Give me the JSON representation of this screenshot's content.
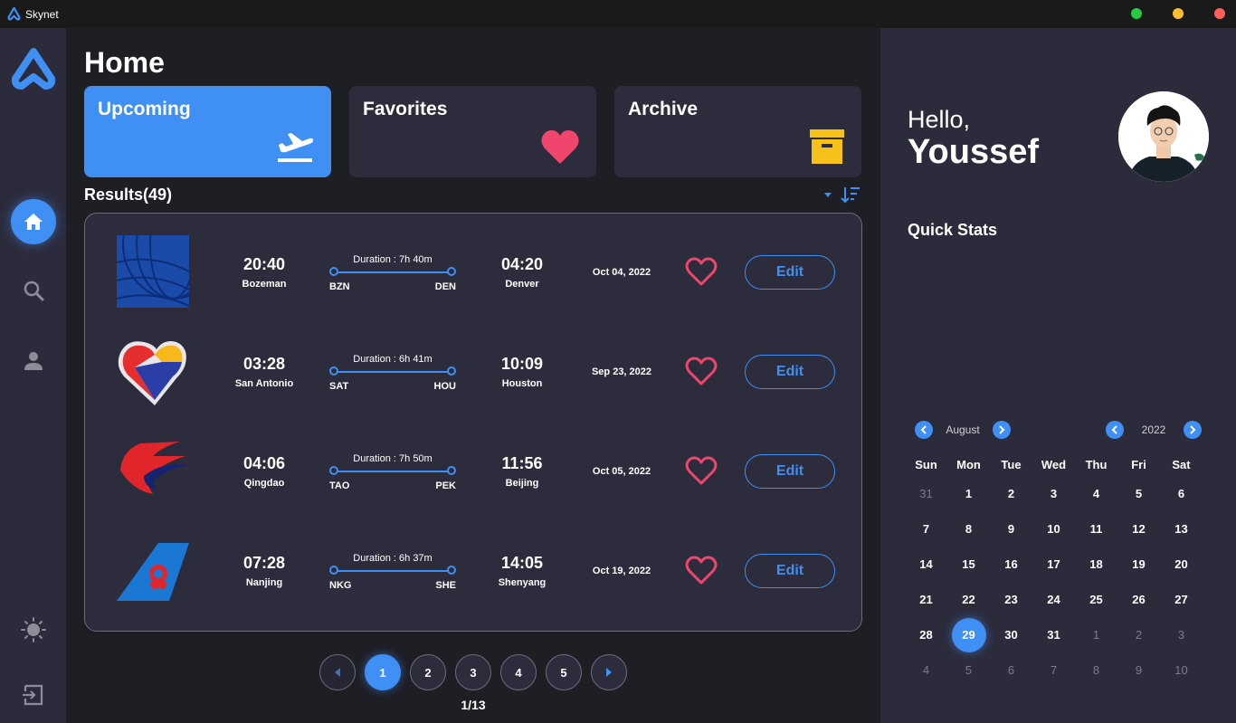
{
  "window": {
    "title": "Skynet",
    "controls": [
      {
        "name": "maximize",
        "color": "#27c93f"
      },
      {
        "name": "minimize",
        "color": "#ffbd2e"
      },
      {
        "name": "close",
        "color": "#ff5f56"
      }
    ]
  },
  "theme": {
    "accent": "#3f8ff5",
    "heart": "#f0466e",
    "archive": "#f6c21a"
  },
  "sidebar": {
    "logo": "skynet-logo-icon",
    "items": [
      {
        "name": "home",
        "icon": "home-icon",
        "active": true
      },
      {
        "name": "search",
        "icon": "search-icon",
        "active": false
      },
      {
        "name": "profile",
        "icon": "user-icon",
        "active": false
      }
    ],
    "bottom": [
      {
        "name": "theme-toggle",
        "icon": "sun-icon"
      },
      {
        "name": "logout",
        "icon": "logout-icon"
      }
    ]
  },
  "main": {
    "title": "Home",
    "categories": [
      {
        "label": "Upcoming",
        "icon": "airplane-departure-icon",
        "active": true
      },
      {
        "label": "Favorites",
        "icon": "heart-icon",
        "active": false
      },
      {
        "label": "Archive",
        "icon": "archive-box-icon",
        "active": false
      }
    ],
    "results_label": "Results(49)",
    "flights": [
      {
        "airline_icon": "united-globe-icon",
        "dep_time": "20:40",
        "dep_city": "Bozeman",
        "duration": "Duration : 7h 40m",
        "from": "BZN",
        "to": "DEN",
        "arr_time": "04:20",
        "arr_city": "Denver",
        "date": "Oct 04, 2022",
        "edit": "Edit"
      },
      {
        "airline_icon": "southwest-heart-icon",
        "dep_time": "03:28",
        "dep_city": "San Antonio",
        "duration": "Duration : 6h 41m",
        "from": "SAT",
        "to": "HOU",
        "arr_time": "10:09",
        "arr_city": "Houston",
        "date": "Sep 23, 2022",
        "edit": "Edit"
      },
      {
        "airline_icon": "china-eastern-icon",
        "dep_time": "04:06",
        "dep_city": "Qingdao",
        "duration": "Duration : 7h 50m",
        "from": "TAO",
        "to": "PEK",
        "arr_time": "11:56",
        "arr_city": "Beijing",
        "date": "Oct 05, 2022",
        "edit": "Edit"
      },
      {
        "airline_icon": "china-southern-icon",
        "dep_time": "07:28",
        "dep_city": "Nanjing",
        "duration": "Duration : 6h 37m",
        "from": "NKG",
        "to": "SHE",
        "arr_time": "14:05",
        "arr_city": "Shenyang",
        "date": "Oct 19, 2022",
        "edit": "Edit"
      }
    ],
    "pagination": {
      "pages": [
        "1",
        "2",
        "3",
        "4",
        "5"
      ],
      "current": "1",
      "summary": "1/13"
    }
  },
  "right": {
    "greeting": "Hello,",
    "username": "Youssef",
    "quick_stats": "Quick Stats",
    "calendar": {
      "month": "August",
      "year": "2022",
      "weekdays": [
        "Sun",
        "Mon",
        "Tue",
        "Wed",
        "Thu",
        "Fri",
        "Sat"
      ],
      "weeks": [
        [
          "31",
          "1",
          "2",
          "3",
          "4",
          "5",
          "6"
        ],
        [
          "7",
          "8",
          "9",
          "10",
          "11",
          "12",
          "13"
        ],
        [
          "14",
          "15",
          "16",
          "17",
          "18",
          "19",
          "20"
        ],
        [
          "21",
          "22",
          "23",
          "24",
          "25",
          "26",
          "27"
        ],
        [
          "28",
          "29",
          "30",
          "31",
          "1",
          "2",
          "3"
        ],
        [
          "4",
          "5",
          "6",
          "7",
          "8",
          "9",
          "10"
        ]
      ],
      "selected": "29"
    }
  }
}
